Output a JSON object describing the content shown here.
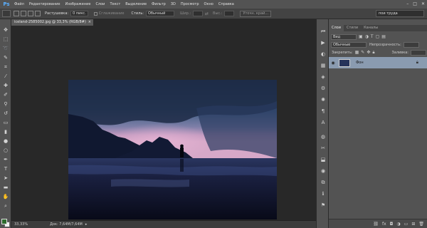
{
  "app": {
    "logo": "Ps"
  },
  "menu": [
    "Файл",
    "Редактирование",
    "Изображение",
    "Слои",
    "Текст",
    "Выделение",
    "Фильтр",
    "3D",
    "Просмотр",
    "Окно",
    "Справка"
  ],
  "window_controls": {
    "minimize": "–",
    "maximize": "□",
    "close": "✕"
  },
  "options": {
    "feather_label": "Растушевка:",
    "feather_value": "0 пикс.",
    "antialias_label": "Сглаживание",
    "style_label": "Стиль:",
    "style_value": "Обычный",
    "width_label": "Шир.:",
    "height_label": "Выс.:",
    "refine_button": "Уточн. край...",
    "workspace": "пои труда"
  },
  "document": {
    "tab_title": "iceland-2585002.jpg @ 33,3% (RGB/8#)",
    "zoom": "33,33%",
    "doc_size": "Док: 7,64M/7,64M"
  },
  "layers_panel": {
    "tabs": [
      "Слои",
      "Стили",
      "Каналы"
    ],
    "filter_label": "Вид",
    "blend_mode": "Обычные",
    "opacity_label": "Непрозрачность:",
    "lock_label": "Закрепить:",
    "fill_label": "Заливка:",
    "layer_name": "Фон"
  },
  "colors": {
    "foreground": "#2d6b2d",
    "background": "#f0f0f0",
    "layer_selected": "#8a9bb0"
  }
}
